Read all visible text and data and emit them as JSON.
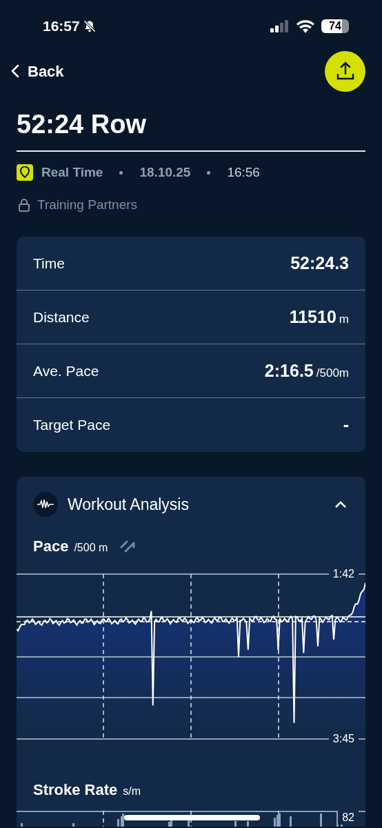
{
  "status_bar": {
    "time": "16:57",
    "battery": "74"
  },
  "nav": {
    "back": "Back"
  },
  "title": "52:24 Row",
  "meta": {
    "type": "Real Time",
    "date": "18.10.25",
    "time": "16:56",
    "privacy": "Training Partners"
  },
  "stats": [
    {
      "label": "Time",
      "value": "52:24.3"
    },
    {
      "label": "Distance",
      "value": "11510",
      "unit": "m"
    },
    {
      "label": "Ave. Pace",
      "value": "2:16.5",
      "unit": "/500m"
    },
    {
      "label": "Target Pace",
      "value": "-"
    }
  ],
  "analysis": {
    "title": "Workout Analysis",
    "expanded": true,
    "pace": {
      "title": "Pace",
      "unit": "/500 m",
      "top_tick": "1:42",
      "bottom_tick": "3:45"
    },
    "stroke_rate": {
      "title": "Stroke Rate",
      "unit": "s/m",
      "top_tick": "82"
    }
  }
}
